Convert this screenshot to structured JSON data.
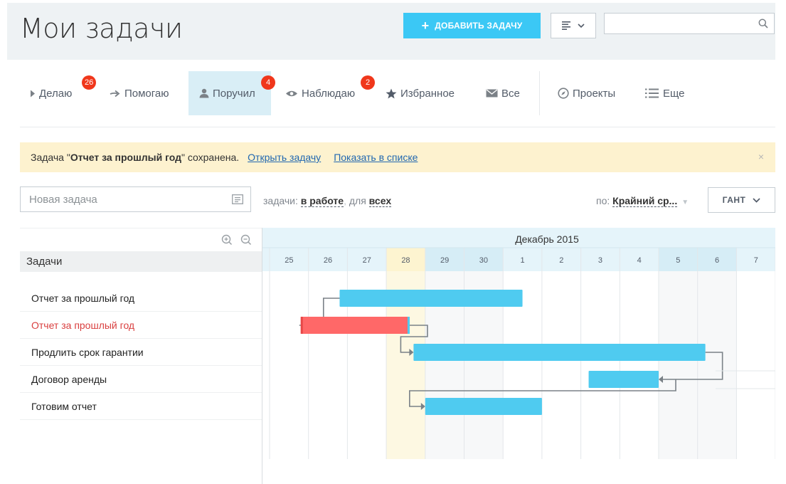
{
  "header": {
    "title": "Мои задачи",
    "add_button_label": "ДОБАВИТЬ ЗАДАЧУ",
    "search_placeholder": ""
  },
  "nav": {
    "items": [
      {
        "label": "Делаю",
        "icon": "triangle-right-icon",
        "badge": "26"
      },
      {
        "label": "Помогаю",
        "icon": "arrow-right-icon"
      },
      {
        "label": "Поручил",
        "icon": "user-icon",
        "badge": "4",
        "active": true
      },
      {
        "label": "Наблюдаю",
        "icon": "eye-icon",
        "badge": "2"
      },
      {
        "label": "Избранное",
        "icon": "star-icon"
      },
      {
        "label": "Все",
        "icon": "envelope-icon"
      },
      {
        "label": "Проекты",
        "icon": "compass-icon"
      },
      {
        "label": "Еще",
        "icon": "list-icon"
      }
    ]
  },
  "notification": {
    "prefix": "Задача \"",
    "task_name": "Отчет за прошлый год",
    "suffix": "\" сохранена.",
    "open_link": "Открыть задачу",
    "show_link": "Показать в списке",
    "close": "×"
  },
  "filters": {
    "new_task_placeholder": "Новая задача",
    "tasks_prefix": "задачи:",
    "status_value": "в работе",
    "for_label": "для",
    "scope_value": "всех",
    "sort_prefix": "по:",
    "sort_value": "Крайний ср...",
    "view_label": "ГАНТ"
  },
  "task_list": {
    "header": "Задачи",
    "tasks": [
      {
        "name": "Отчет за прошлый год",
        "overdue": false
      },
      {
        "name": "Отчет за прошлый год",
        "overdue": true
      },
      {
        "name": "Продлить срок гарантии",
        "overdue": false
      },
      {
        "name": "Договор аренды",
        "overdue": false
      },
      {
        "name": "Готовим отчет",
        "overdue": false
      }
    ]
  },
  "gantt": {
    "month": "Декабрь 2015",
    "days": [
      "25",
      "26",
      "27",
      "28",
      "29",
      "30",
      "1",
      "2",
      "3",
      "4",
      "5",
      "6",
      "7"
    ],
    "today_index": 3,
    "weekend_indices": [
      4,
      5,
      10,
      11
    ],
    "colors": {
      "bar": "#4fcbf0",
      "overdue": "#ff6868",
      "header": "#e5f4fa",
      "header_dark": "#d6edf6",
      "today": "#fdf8e2",
      "weekend": "#f7f8f9",
      "connector": "#7a8187"
    },
    "bars": [
      {
        "task": 0,
        "start": 26.8,
        "end": 31.5,
        "color": "bar"
      },
      {
        "task": 1,
        "start": 25.8,
        "end": 28.6,
        "color": "overdue"
      },
      {
        "task": 2,
        "start": 28.7,
        "end": 36.2,
        "color": "bar"
      },
      {
        "task": 3,
        "start": 33.2,
        "end": 35.0,
        "color": "bar"
      },
      {
        "task": 4,
        "start": 29.0,
        "end": 32.0,
        "color": "bar"
      }
    ],
    "links": [
      {
        "from": 1,
        "to": 0,
        "type": "start-start"
      },
      {
        "from": 1,
        "to": 2,
        "type": "end-start"
      },
      {
        "from": 2,
        "to": 3,
        "type": "end-end"
      },
      {
        "from": 3,
        "to": 4,
        "type": "start-start"
      }
    ]
  }
}
